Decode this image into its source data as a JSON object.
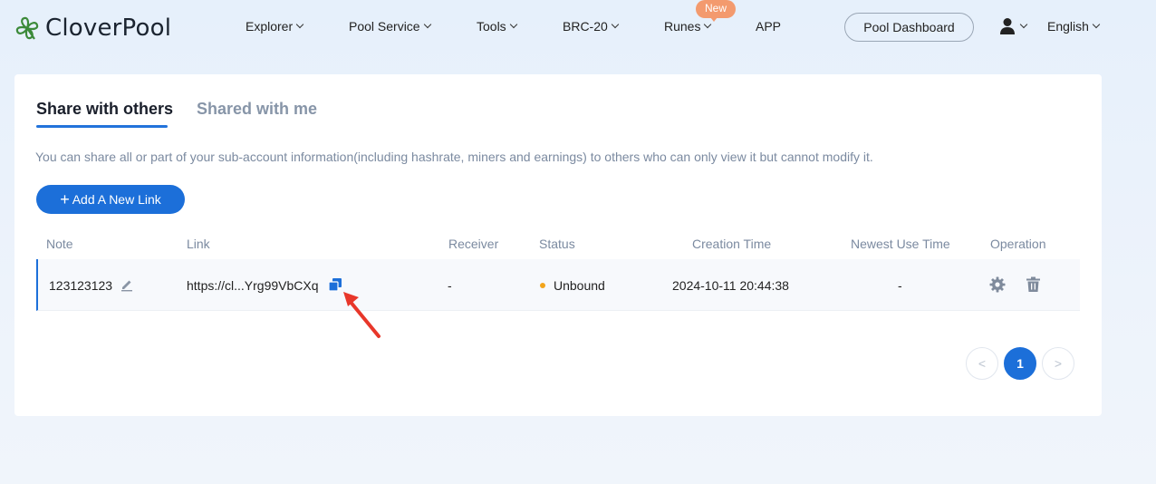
{
  "header": {
    "logo_text": "CloverPool",
    "nav": [
      {
        "label": "Explorer",
        "dropdown": true
      },
      {
        "label": "Pool Service",
        "dropdown": true
      },
      {
        "label": "Tools",
        "dropdown": true
      },
      {
        "label": "BRC-20",
        "dropdown": true
      },
      {
        "label": "Runes",
        "dropdown": true,
        "badge": "New"
      },
      {
        "label": "APP",
        "dropdown": false
      }
    ],
    "pool_dashboard": "Pool Dashboard",
    "language": "English",
    "user_icon": "user-icon"
  },
  "tabs": {
    "active": "Share with others",
    "inactive": "Shared with me"
  },
  "description": "You can share all or part of your sub-account information(including hashrate, miners and earnings) to others who can only view it but cannot modify it.",
  "add_button": {
    "plus": "+",
    "label": "Add A New Link"
  },
  "table": {
    "headers": {
      "note": "Note",
      "link": "Link",
      "receiver": "Receiver",
      "status": "Status",
      "creation_time": "Creation Time",
      "newest_use_time": "Newest Use Time",
      "operation": "Operation"
    },
    "rows": [
      {
        "note": "123123123",
        "link": "https://cl...Yrg99VbCXq",
        "receiver": "-",
        "status": "Unbound",
        "creation_time": "2024-10-11 20:44:38",
        "newest_use_time": "-"
      }
    ]
  },
  "pagination": {
    "prev": "<",
    "current": "1",
    "next": ">"
  },
  "colors": {
    "accent": "#1c6fd9",
    "status_dot": "#f2a51c",
    "badge": "#f39a6e",
    "arrow": "#e8372a"
  }
}
